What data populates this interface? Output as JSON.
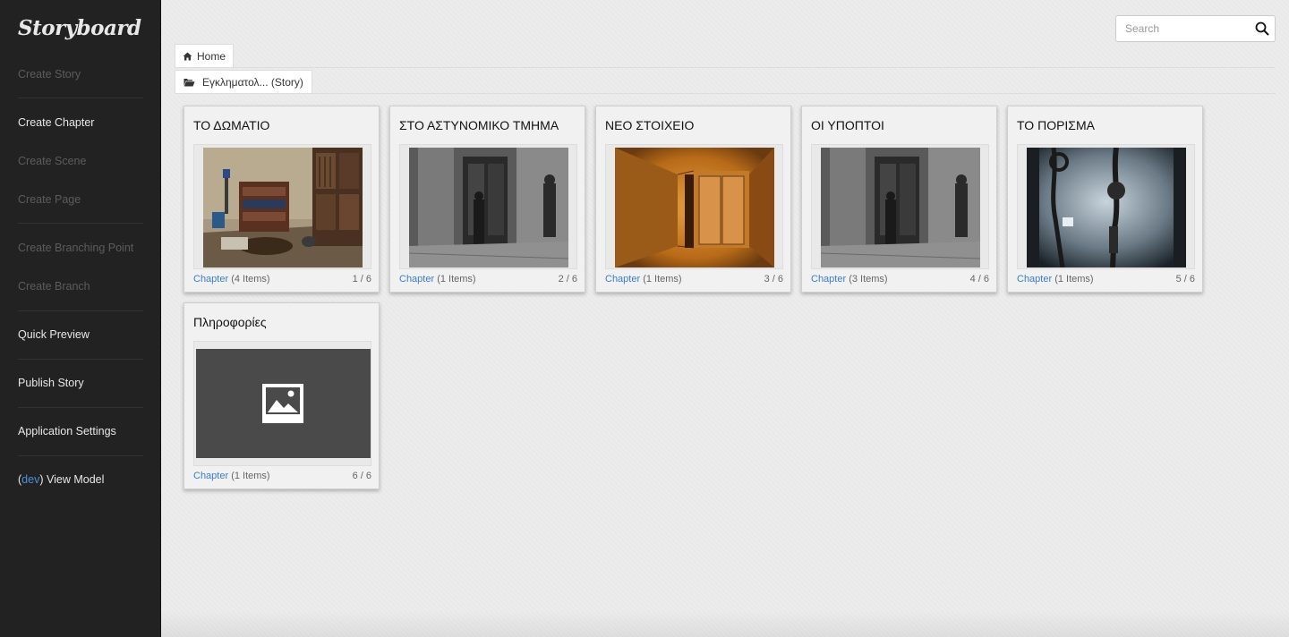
{
  "brand": "Storyboard",
  "sidebar": {
    "items": [
      {
        "label": "Create Story",
        "enabled": false
      },
      {
        "label": "Create Chapter",
        "enabled": true
      },
      {
        "label": "Create Scene",
        "enabled": false
      },
      {
        "label": "Create Page",
        "enabled": false
      },
      {
        "label": "Create Branching Point",
        "enabled": false
      },
      {
        "label": "Create Branch",
        "enabled": false
      },
      {
        "label": "Quick Preview",
        "enabled": true
      },
      {
        "label": "Publish Story",
        "enabled": true
      },
      {
        "label": "Application Settings",
        "enabled": true
      }
    ],
    "dev": {
      "open": "(",
      "tag": "dev",
      "close": ")",
      "label": "View Model"
    }
  },
  "search": {
    "placeholder": "Search",
    "value": ""
  },
  "breadcrumb": {
    "home": "Home",
    "story": "Εγκληματολ... (Story)"
  },
  "cards": [
    {
      "title": "ΤΟ ΔΩΜΑΤΙΟ",
      "type": "Chapter",
      "items": "(4 Items)",
      "position": "1 / 6"
    },
    {
      "title": "ΣΤΟ ΑΣΤΥΝΟΜΙΚΟ ΤΜΗΜΑ",
      "type": "Chapter",
      "items": "(1 Items)",
      "position": "2 / 6"
    },
    {
      "title": "ΝΕΟ ΣΤΟΙΧΕΙΟ",
      "type": "Chapter",
      "items": "(1 Items)",
      "position": "3 / 6"
    },
    {
      "title": "ΟΙ ΥΠΟΠΤΟΙ",
      "type": "Chapter",
      "items": "(3 Items)",
      "position": "4 / 6"
    },
    {
      "title": "ΤΟ ΠΟΡΙΣΜΑ",
      "type": "Chapter",
      "items": "(1 Items)",
      "position": "5 / 6"
    },
    {
      "title": "Πληροφορίες",
      "type": "Chapter",
      "items": "(1 Items)",
      "position": "6 / 6"
    }
  ],
  "colors": {
    "sidebar": "#222222",
    "link": "#3a7dc9",
    "background": "#ececec"
  }
}
